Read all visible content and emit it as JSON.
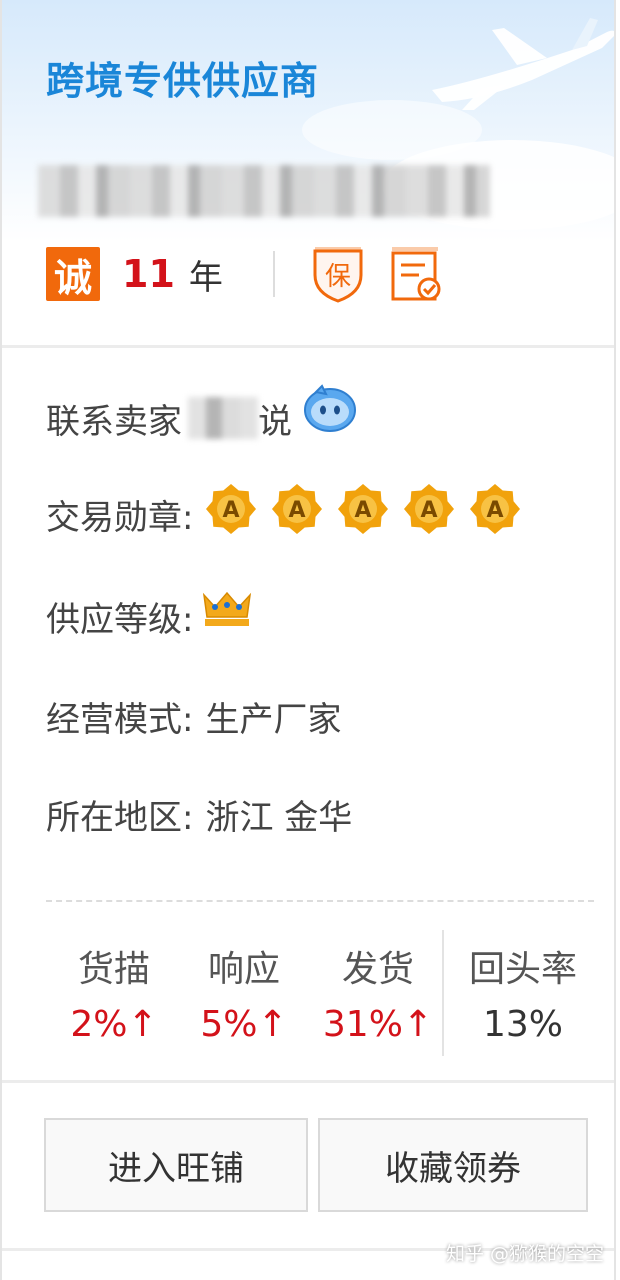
{
  "header": {
    "title": "跨境专供供应商",
    "cheng_badge": "诚",
    "years_number": "11",
    "years_unit": "年",
    "icons": [
      "plane-icon",
      "bao-shield-icon",
      "contract-check-icon"
    ]
  },
  "info": {
    "contact_label": "联系卖家",
    "contact_name_suffix": "说",
    "contact_icon": "wangwang-chat-icon",
    "medal_label": "交易勋章:",
    "medal_letter": "A",
    "medal_count": 5,
    "supply_label": "供应等级:",
    "supply_icon": "crown-icon",
    "mode_label": "经营模式:",
    "mode_value": "生产厂家",
    "region_label": "所在地区:",
    "region_value": "浙江 金华"
  },
  "stats": [
    {
      "label": "货描",
      "value": "2%↑"
    },
    {
      "label": "响应",
      "value": "5%↑"
    },
    {
      "label": "发货",
      "value": "31%↑"
    },
    {
      "label": "回头率",
      "value": "13%"
    }
  ],
  "buttons": {
    "enter_shop": "进入旺铺",
    "collect_coupon": "收藏领券"
  },
  "watermark": "知乎 @猕猴的空空",
  "colors": {
    "title_blue": "#1a86d8",
    "cheng_orange": "#f1690c",
    "up_red": "#d3121a",
    "medal_gold": "#f1a20c"
  }
}
